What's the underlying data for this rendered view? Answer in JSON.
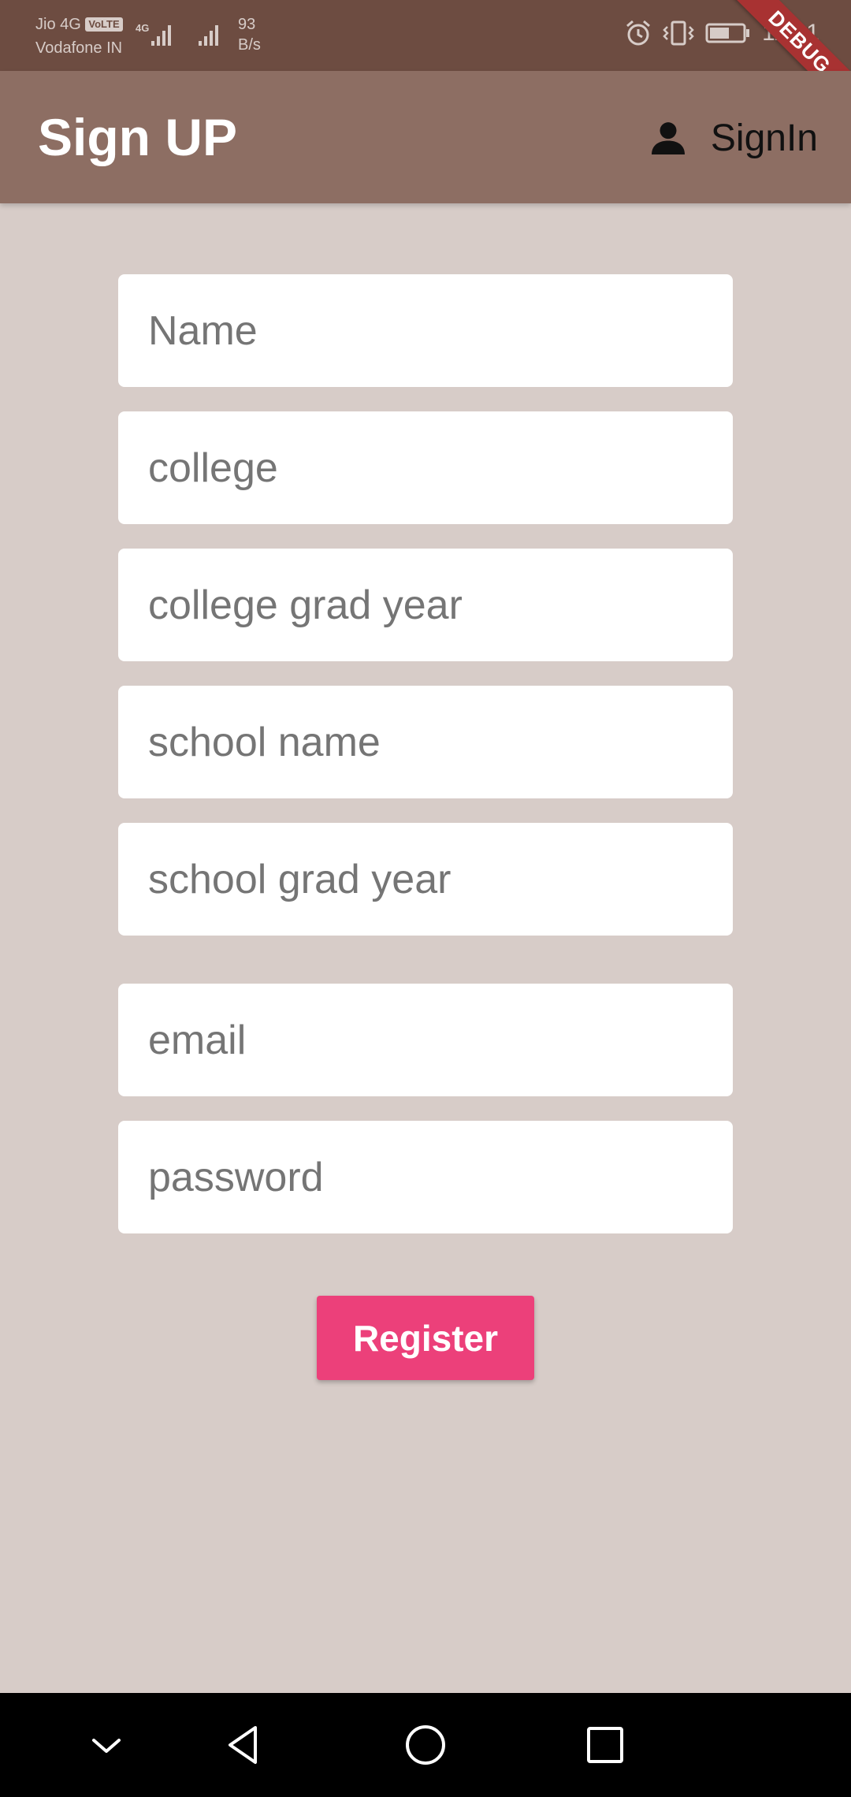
{
  "status_bar": {
    "carrier_1": "Jio 4G",
    "volte_badge": "VoLTE",
    "carrier_2": "Vodafone IN",
    "network_type": "4G",
    "net_speed_value": "93",
    "net_speed_unit": "B/s",
    "time": "11:31",
    "icons": [
      "alarm-icon",
      "vibrate-icon",
      "battery-icon"
    ]
  },
  "debug_banner": "DEBUG",
  "app_bar": {
    "title": "Sign UP",
    "signin_label": "SignIn",
    "signin_icon": "person-icon"
  },
  "form": {
    "fields": [
      {
        "placeholder": "Name",
        "value": ""
      },
      {
        "placeholder": "college",
        "value": ""
      },
      {
        "placeholder": "college grad year",
        "value": ""
      },
      {
        "placeholder": "school name",
        "value": ""
      },
      {
        "placeholder": "school grad year",
        "value": ""
      },
      {
        "placeholder": "email",
        "value": ""
      },
      {
        "placeholder": "password",
        "value": ""
      }
    ],
    "register_label": "Register"
  },
  "colors": {
    "status_bar": "#6d4c41",
    "app_bar": "#8d6e63",
    "background": "#d7ccc8",
    "button": "#ec407a"
  },
  "nav_bar": {
    "buttons": [
      "chevron-down-icon",
      "back-triangle-icon",
      "home-circle-icon",
      "recents-square-icon"
    ]
  }
}
